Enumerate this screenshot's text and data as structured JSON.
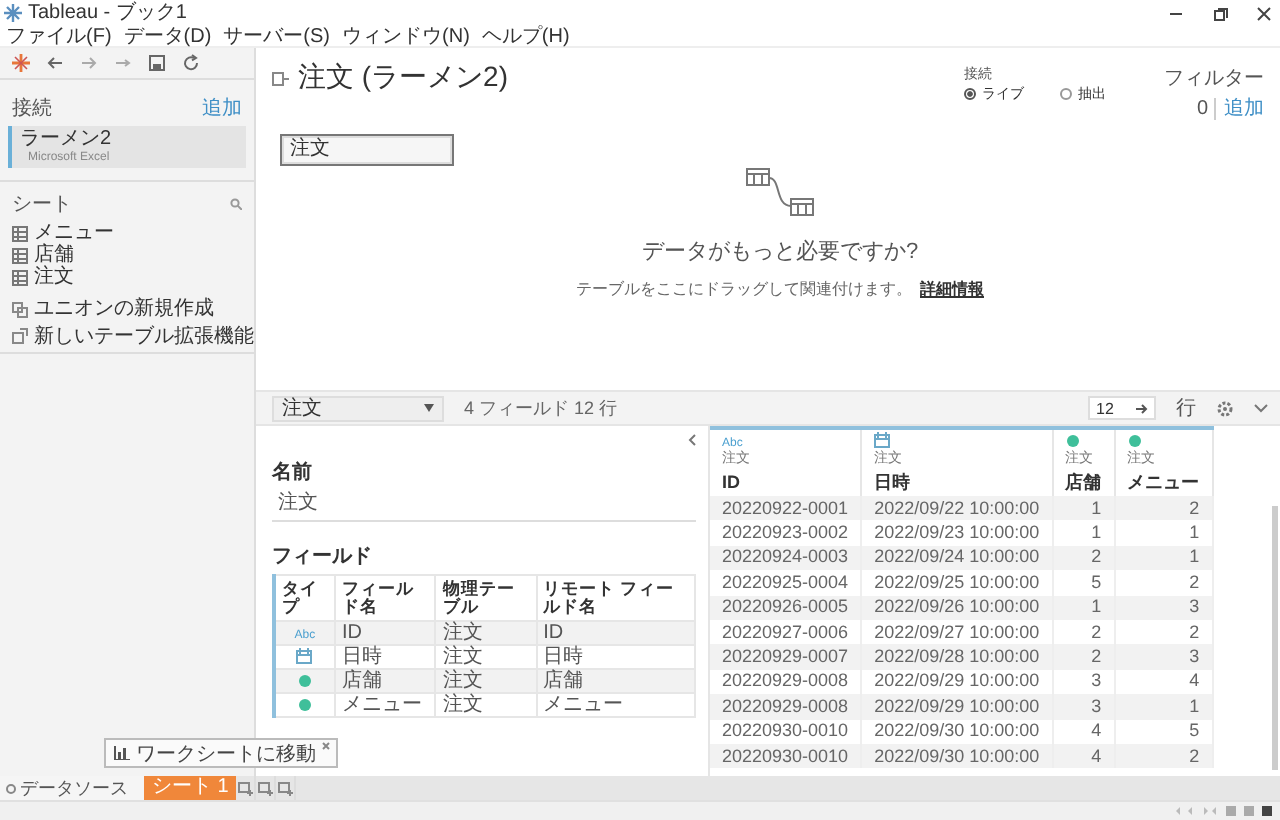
{
  "window": {
    "title": "Tableau - ブック1"
  },
  "menu": [
    "ファイル(F)",
    "データ(D)",
    "サーバー(S)",
    "ウィンドウ(N)",
    "ヘルプ(H)"
  ],
  "sidebar": {
    "connections_label": "接続",
    "add_link": "追加",
    "connections": [
      {
        "name": "ラーメン2",
        "type": "Microsoft Excel",
        "selected": true
      }
    ],
    "sheets_label": "シート",
    "sheets": [
      "メニュー",
      "店舗",
      "注文"
    ],
    "actions": [
      {
        "kind": "union",
        "label": "ユニオンの新規作成"
      },
      {
        "kind": "extension",
        "label": "新しいテーブル拡張機能"
      }
    ]
  },
  "datasource": {
    "title": "注文 (ラーメン2)",
    "connection": {
      "label": "接続",
      "options": [
        {
          "label": "ライブ",
          "selected": true
        },
        {
          "label": "抽出",
          "selected": false
        }
      ]
    },
    "filters": {
      "label": "フィルター",
      "count": "0",
      "add_link": "追加"
    }
  },
  "canvas": {
    "tables": [
      "注文"
    ],
    "hint_title": "データがもっと必要ですか?",
    "hint_text": "テーブルをここにドラッグして関連付けます。",
    "hint_link": "詳細情報"
  },
  "toolbar": {
    "table_select": "注文",
    "summary": "4 フィールド 12 行",
    "rows_value": "12",
    "rows_label": "行"
  },
  "metadata": {
    "name_label": "名前",
    "name_value": "注文",
    "fields_label": "フィールド",
    "columns": [
      "タイプ",
      "フィールド名",
      "物理テーブル",
      "リモート フィールド名"
    ],
    "fields": [
      {
        "kind": "string",
        "type_label": "Abc",
        "name": "ID",
        "table": "注文",
        "remote": "ID"
      },
      {
        "kind": "datetime",
        "name": "日時",
        "table": "注文",
        "remote": "日時"
      },
      {
        "kind": "number",
        "name": "店舗",
        "table": "注文",
        "remote": "店舗"
      },
      {
        "kind": "number",
        "name": "メニュー",
        "table": "注文",
        "remote": "メニュー"
      }
    ]
  },
  "grid": {
    "columns": [
      {
        "kind": "string",
        "type_label": "Abc",
        "table": "注文",
        "name": "ID"
      },
      {
        "kind": "datetime",
        "table": "注文",
        "name": "日時"
      },
      {
        "kind": "number",
        "table": "注文",
        "name": "店舗"
      },
      {
        "kind": "number",
        "table": "注文",
        "name": "メニュー"
      }
    ],
    "rows": [
      [
        "20220922-0001",
        "2022/09/22 10:00:00",
        "1",
        "2"
      ],
      [
        "20220923-0002",
        "2022/09/23 10:00:00",
        "1",
        "1"
      ],
      [
        "20220924-0003",
        "2022/09/24 10:00:00",
        "2",
        "1"
      ],
      [
        "20220925-0004",
        "2022/09/25 10:00:00",
        "5",
        "2"
      ],
      [
        "20220926-0005",
        "2022/09/26 10:00:00",
        "1",
        "3"
      ],
      [
        "20220927-0006",
        "2022/09/27 10:00:00",
        "2",
        "2"
      ],
      [
        "20220929-0007",
        "2022/09/28 10:00:00",
        "2",
        "3"
      ],
      [
        "20220929-0008",
        "2022/09/29 10:00:00",
        "3",
        "4"
      ],
      [
        "20220929-0008",
        "2022/09/29 10:00:00",
        "3",
        "1"
      ],
      [
        "20220930-0010",
        "2022/09/30 10:00:00",
        "4",
        "5"
      ],
      [
        "20220930-0010",
        "2022/09/30 10:00:00",
        "4",
        "2"
      ]
    ]
  },
  "bottom": {
    "datasource_tab": "データソース",
    "sheets": [
      {
        "label": "シート 1",
        "selected": true
      }
    ],
    "tooltip": "ワークシートに移動"
  }
}
